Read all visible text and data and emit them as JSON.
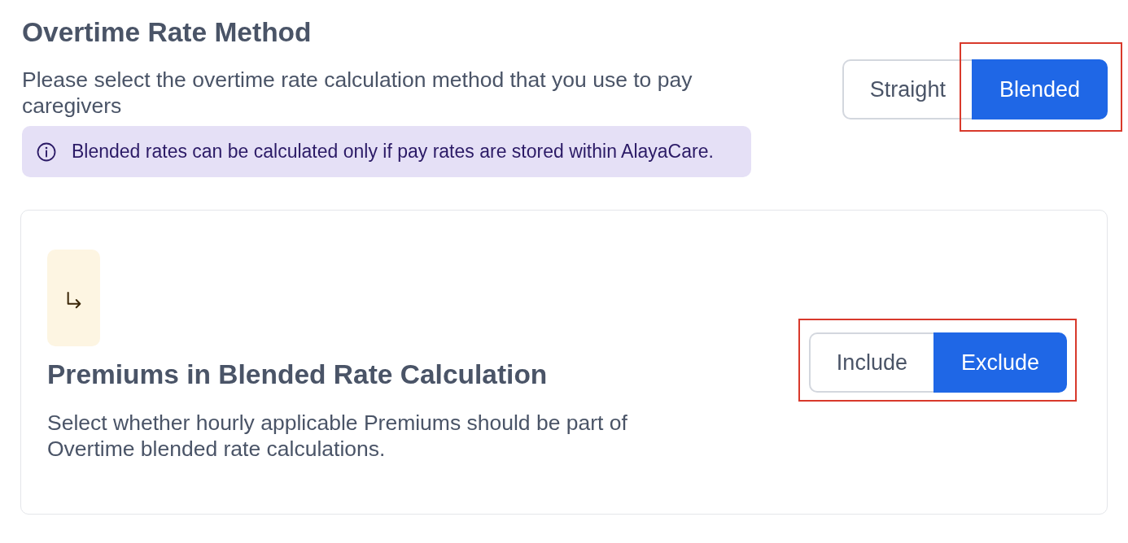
{
  "method": {
    "title": "Overtime Rate Method",
    "description": "Please select the overtime rate calculation method that you use to pay caregivers",
    "notice": "Blended rates can be calculated only if pay rates are stored within AlayaCare.",
    "toggle": {
      "highlighted": false,
      "options": [
        {
          "label": "Straight",
          "selected": false,
          "highlighted": false
        },
        {
          "label": "Blended",
          "selected": true,
          "highlighted": true
        }
      ]
    }
  },
  "premiums_card": {
    "title": "Premiums in Blended Rate Calculation",
    "description": "Select whether hourly applicable Premiums should be part of Overtime blended rate calculations.",
    "toggle": {
      "highlighted": true,
      "options": [
        {
          "label": "Include",
          "selected": false,
          "highlighted": false
        },
        {
          "label": "Exclude",
          "selected": true,
          "highlighted": false
        }
      ]
    }
  }
}
